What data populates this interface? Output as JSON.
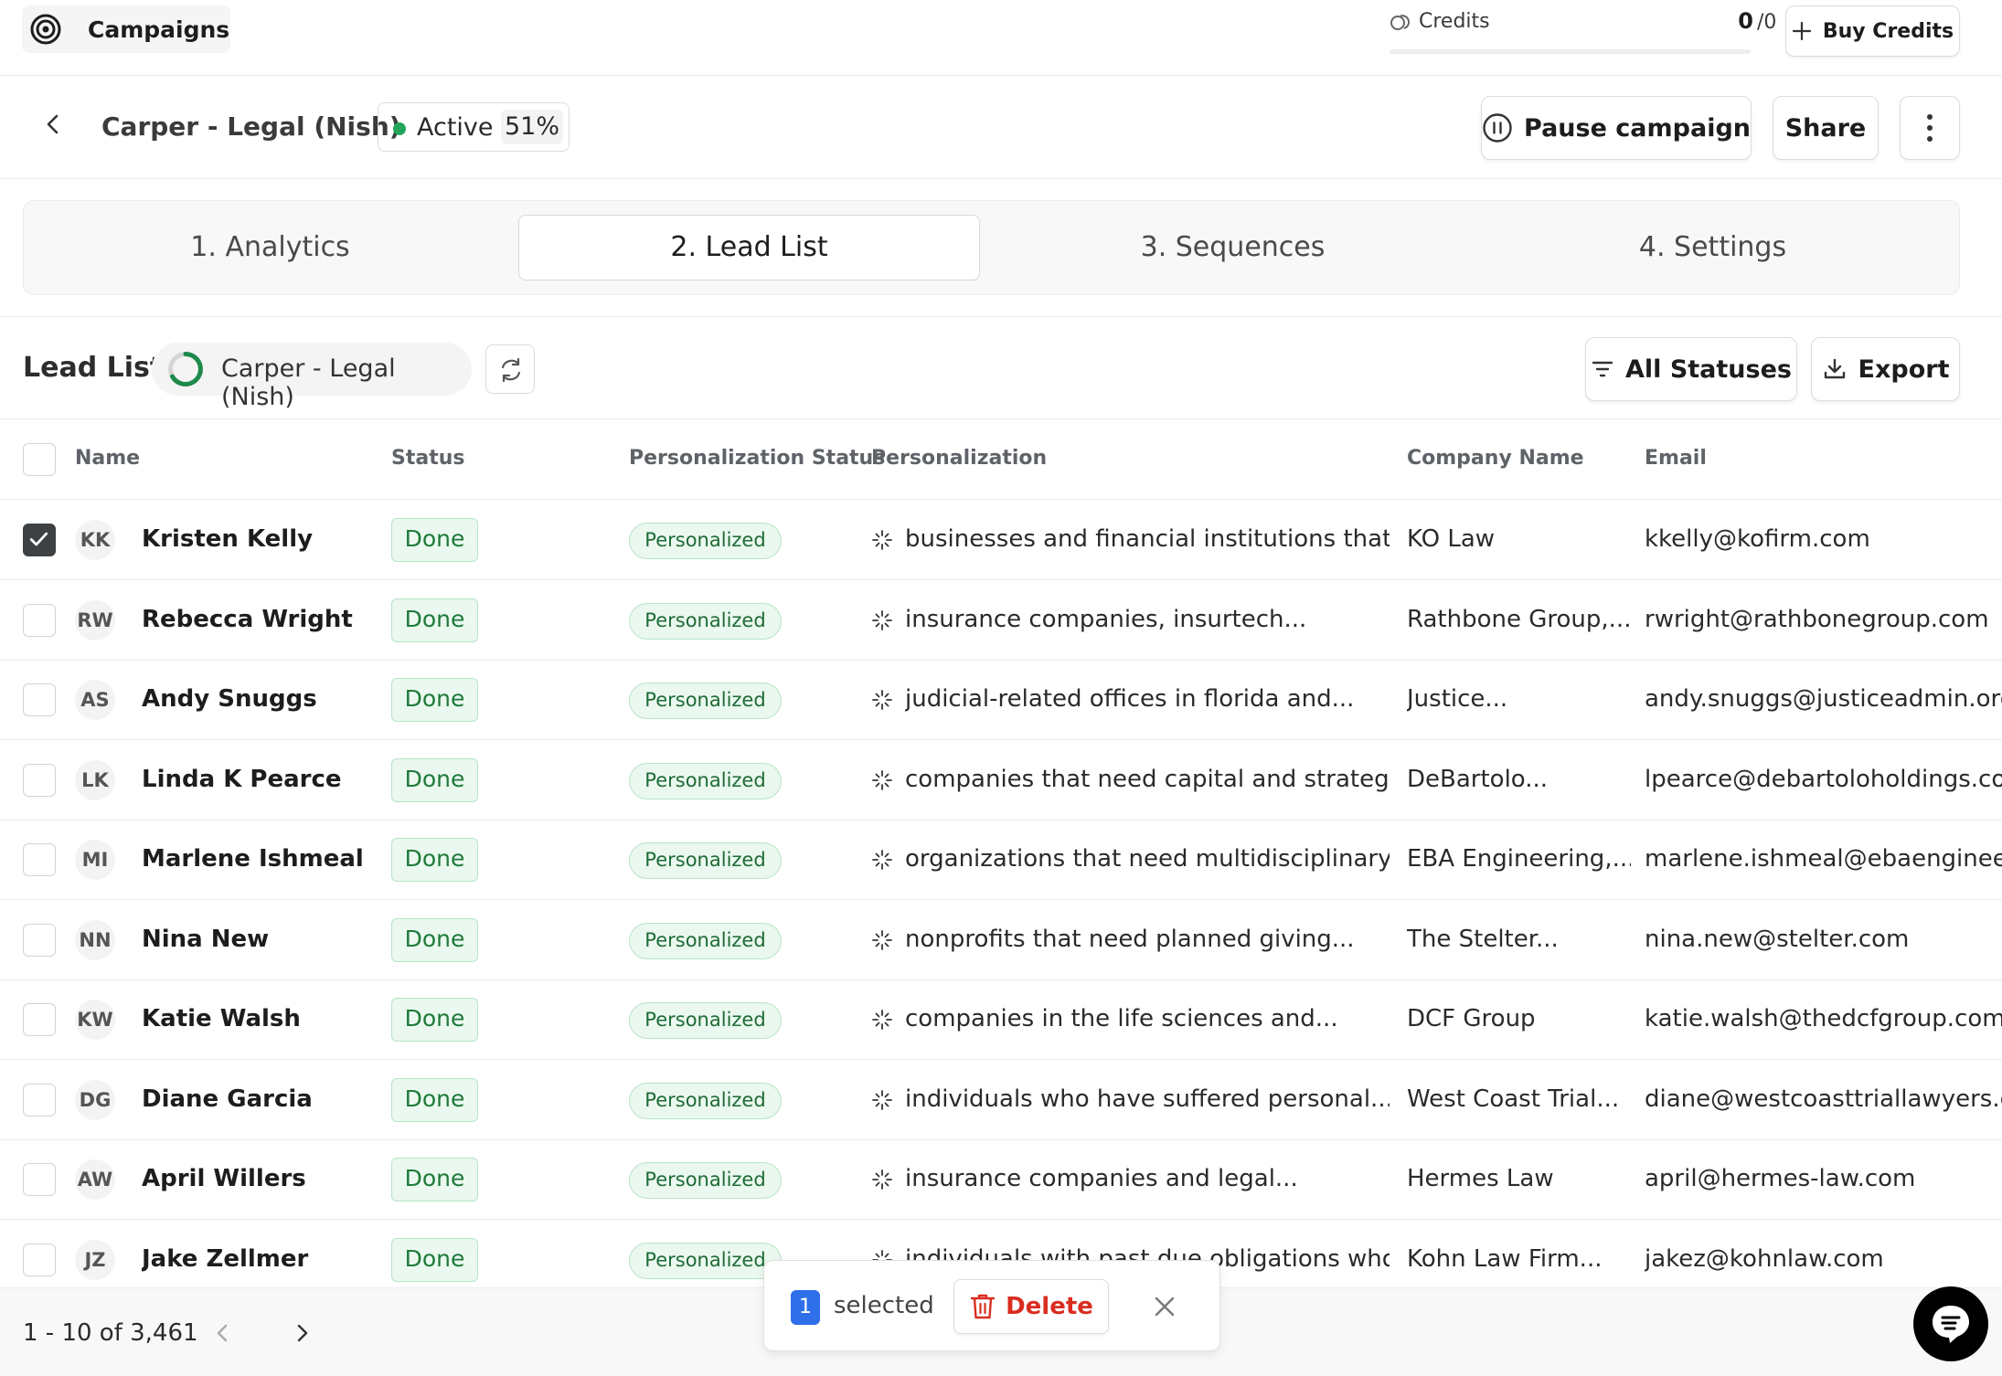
{
  "topbar": {
    "app_title": "Campaigns",
    "credits_label": "Credits",
    "credits_used": "0",
    "credits_total": "/0",
    "buy_credits": "Buy Credits"
  },
  "campaign": {
    "back_icon": "chevron-left-icon",
    "title": "Carper - Legal (Nish)",
    "status": "Active",
    "progress": "51%",
    "status_color": "#22a55a",
    "pause_label": "Pause campaign",
    "share_label": "Share"
  },
  "tabs": [
    {
      "label": "1. Analytics",
      "active": false
    },
    {
      "label": "2. Lead List",
      "active": true
    },
    {
      "label": "3. Sequences",
      "active": false
    },
    {
      "label": "4. Settings",
      "active": false
    }
  ],
  "lead_list": {
    "title": "Lead List",
    "list_name": "Carper - Legal (Nish)",
    "statuses_label": "All Statuses",
    "export_label": "Export"
  },
  "table": {
    "columns": [
      "Name",
      "Status",
      "Personalization Status",
      "Personalization",
      "Company Name",
      "Email"
    ],
    "rows": [
      {
        "initials": "KK",
        "name": "Kristen Kelly",
        "status": "Done",
        "pstatus": "Personalized",
        "personalization": "businesses and financial institutions that...",
        "company": "KO Law",
        "email": "kkelly@kofirm.com",
        "checked": true
      },
      {
        "initials": "RW",
        "name": "Rebecca Wright",
        "status": "Done",
        "pstatus": "Personalized",
        "personalization": "insurance companies, insurtech...",
        "company": "Rathbone Group,...",
        "email": "rwright@rathbonegroup.com",
        "checked": false
      },
      {
        "initials": "AS",
        "name": "Andy Snuggs",
        "status": "Done",
        "pstatus": "Personalized",
        "personalization": "judicial-related offices in florida and...",
        "company": "Justice...",
        "email": "andy.snuggs@justiceadmin.org",
        "checked": false
      },
      {
        "initials": "LK",
        "name": "Linda K Pearce",
        "status": "Done",
        "pstatus": "Personalized",
        "personalization": "companies that need capital and strategi...",
        "company": "DeBartolo...",
        "email": "lpearce@debartoloholdings.com",
        "checked": false
      },
      {
        "initials": "MI",
        "name": "Marlene Ishmeal",
        "status": "Done",
        "pstatus": "Personalized",
        "personalization": "organizations that need multidisciplinary...",
        "company": "EBA Engineering,...",
        "email": "marlene.ishmeal@ebaengineerin",
        "checked": false
      },
      {
        "initials": "NN",
        "name": "Nina New",
        "status": "Done",
        "pstatus": "Personalized",
        "personalization": "nonprofits that need planned giving...",
        "company": "The Stelter...",
        "email": "nina.new@stelter.com",
        "checked": false
      },
      {
        "initials": "KW",
        "name": "Katie Walsh",
        "status": "Done",
        "pstatus": "Personalized",
        "personalization": "companies in the life sciences and...",
        "company": "DCF Group",
        "email": "katie.walsh@thedcfgroup.com",
        "checked": false
      },
      {
        "initials": "DG",
        "name": "Diane Garcia",
        "status": "Done",
        "pstatus": "Personalized",
        "personalization": "individuals who have suffered personal...",
        "company": "West Coast Trial...",
        "email": "diane@westcoasttriallawyers.co",
        "checked": false
      },
      {
        "initials": "AW",
        "name": "April Willers",
        "status": "Done",
        "pstatus": "Personalized",
        "personalization": "insurance companies and legal...",
        "company": "Hermes Law",
        "email": "april@hermes-law.com",
        "checked": false
      },
      {
        "initials": "JZ",
        "name": "Jake Zellmer",
        "status": "Done",
        "pstatus": "Personalized",
        "personalization": "individuals with past due obligations who...",
        "company": "Kohn Law Firm...",
        "email": "jakez@kohnlaw.com",
        "checked": false
      }
    ]
  },
  "footer": {
    "pagination": "1 - 10 of 3,461"
  },
  "selection": {
    "count": "1",
    "label": "selected",
    "delete_label": "Delete"
  },
  "colors": {
    "accent_blue": "#2f6fea",
    "danger_red": "#d92d20",
    "success_green": "#1e7a3a"
  }
}
